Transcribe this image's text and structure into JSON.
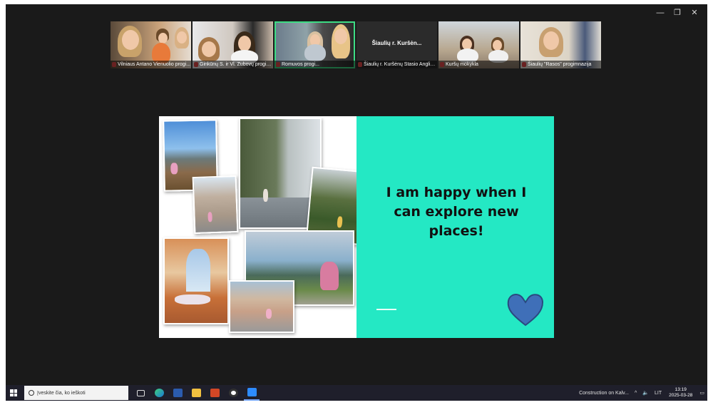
{
  "window": {
    "controls": [
      "—",
      "❐",
      "✕"
    ]
  },
  "participants": [
    {
      "label": "Vilniaus Antano Vienuolio progi..."
    },
    {
      "label": "Ginkūnų S. ir Vl. Zubovų progimn..."
    },
    {
      "label": "Romuvos progi..."
    },
    {
      "label": "Šiaulių r. Kuršėnų Stasio Anglicki...",
      "display_name": "Šiaulių r. Kuršėn..."
    },
    {
      "label": "Kuršų mokykla"
    },
    {
      "label": "Šiaulių \"Rasos\" progimnazija"
    }
  ],
  "slide": {
    "text": "I am happy when I can explore new places!",
    "accent_color": "#24e8c4",
    "heart_color": "#3f6fb8"
  },
  "taskbar": {
    "search_placeholder": "Įveskite čia, ko ieškoti",
    "apps": [
      "edge-icon",
      "word-icon",
      "explorer-icon",
      "powerpoint-icon",
      "media-icon",
      "zoom-icon"
    ],
    "notification": "Construction on Kalv...",
    "language": "LIT",
    "time": "13:19",
    "date": "2025-03-28"
  }
}
